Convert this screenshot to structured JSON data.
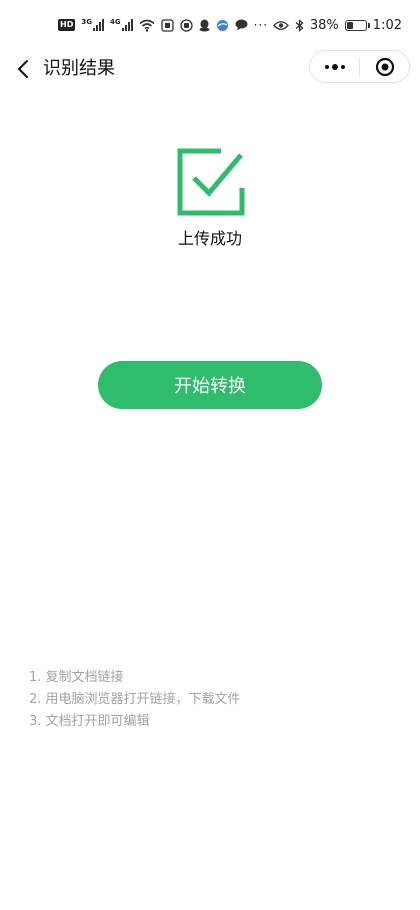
{
  "status_bar": {
    "hd_label": "HD",
    "net1_label": "3G",
    "net2_label": "4G",
    "more": "···",
    "battery_percent": "38%",
    "battery_level": 0.38,
    "time": "1:02"
  },
  "nav": {
    "title": "识别结果"
  },
  "result": {
    "status_text": "上传成功",
    "icon": "checkbox-checked-icon",
    "accent_color": "#2dbd6b"
  },
  "actions": {
    "start_label": "开始转换"
  },
  "instructions": [
    "1. 复制文档链接",
    "2. 用电脑浏览器打开链接，下载文件",
    "3. 文档打开即可编辑"
  ]
}
